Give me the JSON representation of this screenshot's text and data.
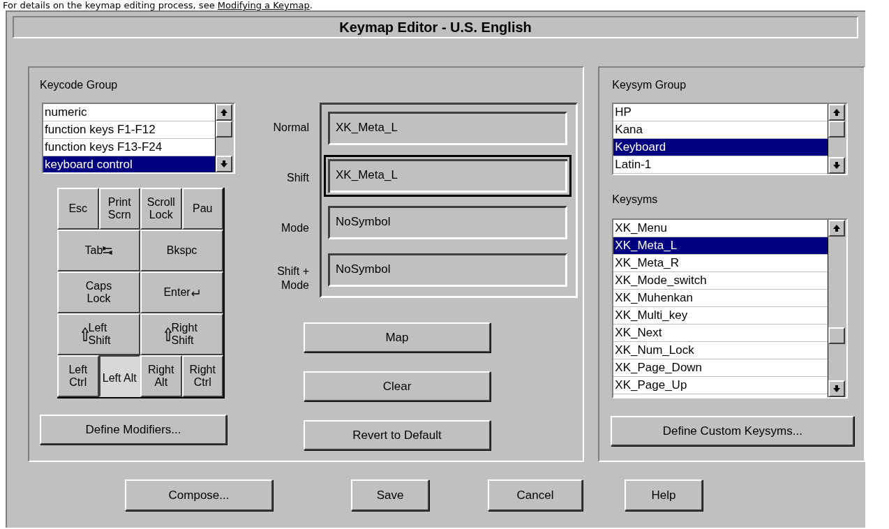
{
  "intro": {
    "text": "For details on the keymap editing process, see ",
    "link": "Modifying a Keymap",
    "end": "."
  },
  "window": {
    "title": "Keymap Editor - U.S. English"
  },
  "keycode_group": {
    "label": "Keycode Group",
    "items": [
      {
        "text": "numeric",
        "selected": false
      },
      {
        "text": "function keys F1-F12",
        "selected": false
      },
      {
        "text": "function keys F13-F24",
        "selected": false
      },
      {
        "text": "keyboard control",
        "selected": true
      }
    ]
  },
  "keys": [
    [
      {
        "label": "Esc",
        "kind": "plain",
        "selected": false
      },
      {
        "label": "Print Scrn",
        "kind": "plain",
        "selected": false
      },
      {
        "label": "Scroll Lock",
        "kind": "plain",
        "selected": false
      },
      {
        "label": "Pau",
        "kind": "plain",
        "selected": false
      }
    ],
    [
      {
        "label": "Tab",
        "kind": "tab",
        "selected": false
      },
      {
        "label": "Bkspc",
        "kind": "plain",
        "selected": false
      }
    ],
    [
      {
        "label": "Caps Lock",
        "kind": "plain",
        "selected": false
      },
      {
        "label": "Enter",
        "kind": "enter",
        "selected": false
      }
    ],
    [
      {
        "label": "Left Shift",
        "kind": "shift",
        "selected": false
      },
      {
        "label": "Right Shift",
        "kind": "shift",
        "selected": false
      }
    ],
    [
      {
        "label": "Left Ctrl",
        "kind": "plain",
        "selected": false
      },
      {
        "label": "Left Alt",
        "kind": "plain",
        "selected": true
      },
      {
        "label": "Right Alt",
        "kind": "plain",
        "selected": false
      },
      {
        "label": "Right Ctrl",
        "kind": "plain",
        "selected": false
      }
    ]
  ],
  "define_modifiers": "Define Modifiers...",
  "mappings": [
    {
      "label": "Normal",
      "value": "XK_Meta_L",
      "focused": false
    },
    {
      "label": "Shift",
      "value": "XK_Meta_L",
      "focused": true
    },
    {
      "label": "Mode",
      "value": "NoSymbol",
      "focused": false
    },
    {
      "label": "Shift + Mode",
      "value": "NoSymbol",
      "focused": false
    }
  ],
  "actions": [
    "Map",
    "Clear",
    "Revert to Default"
  ],
  "keysym_group": {
    "label": "Keysym Group",
    "items": [
      {
        "text": "HP",
        "selected": false
      },
      {
        "text": "Kana",
        "selected": false
      },
      {
        "text": "Keyboard",
        "selected": true
      },
      {
        "text": "Latin-1",
        "selected": false
      }
    ]
  },
  "keysyms": {
    "label": "Keysyms",
    "items": [
      {
        "text": "XK_Menu",
        "selected": false
      },
      {
        "text": "XK_Meta_L",
        "selected": true
      },
      {
        "text": "XK_Meta_R",
        "selected": false
      },
      {
        "text": "XK_Mode_switch",
        "selected": false
      },
      {
        "text": "XK_Muhenkan",
        "selected": false
      },
      {
        "text": "XK_Multi_key",
        "selected": false
      },
      {
        "text": "XK_Next",
        "selected": false
      },
      {
        "text": "XK_Num_Lock",
        "selected": false
      },
      {
        "text": "XK_Page_Down",
        "selected": false
      },
      {
        "text": "XK_Page_Up",
        "selected": false
      }
    ]
  },
  "define_custom": "Define Custom Keysyms...",
  "buttons": [
    "Compose...",
    "Save",
    "Cancel",
    "Help"
  ]
}
